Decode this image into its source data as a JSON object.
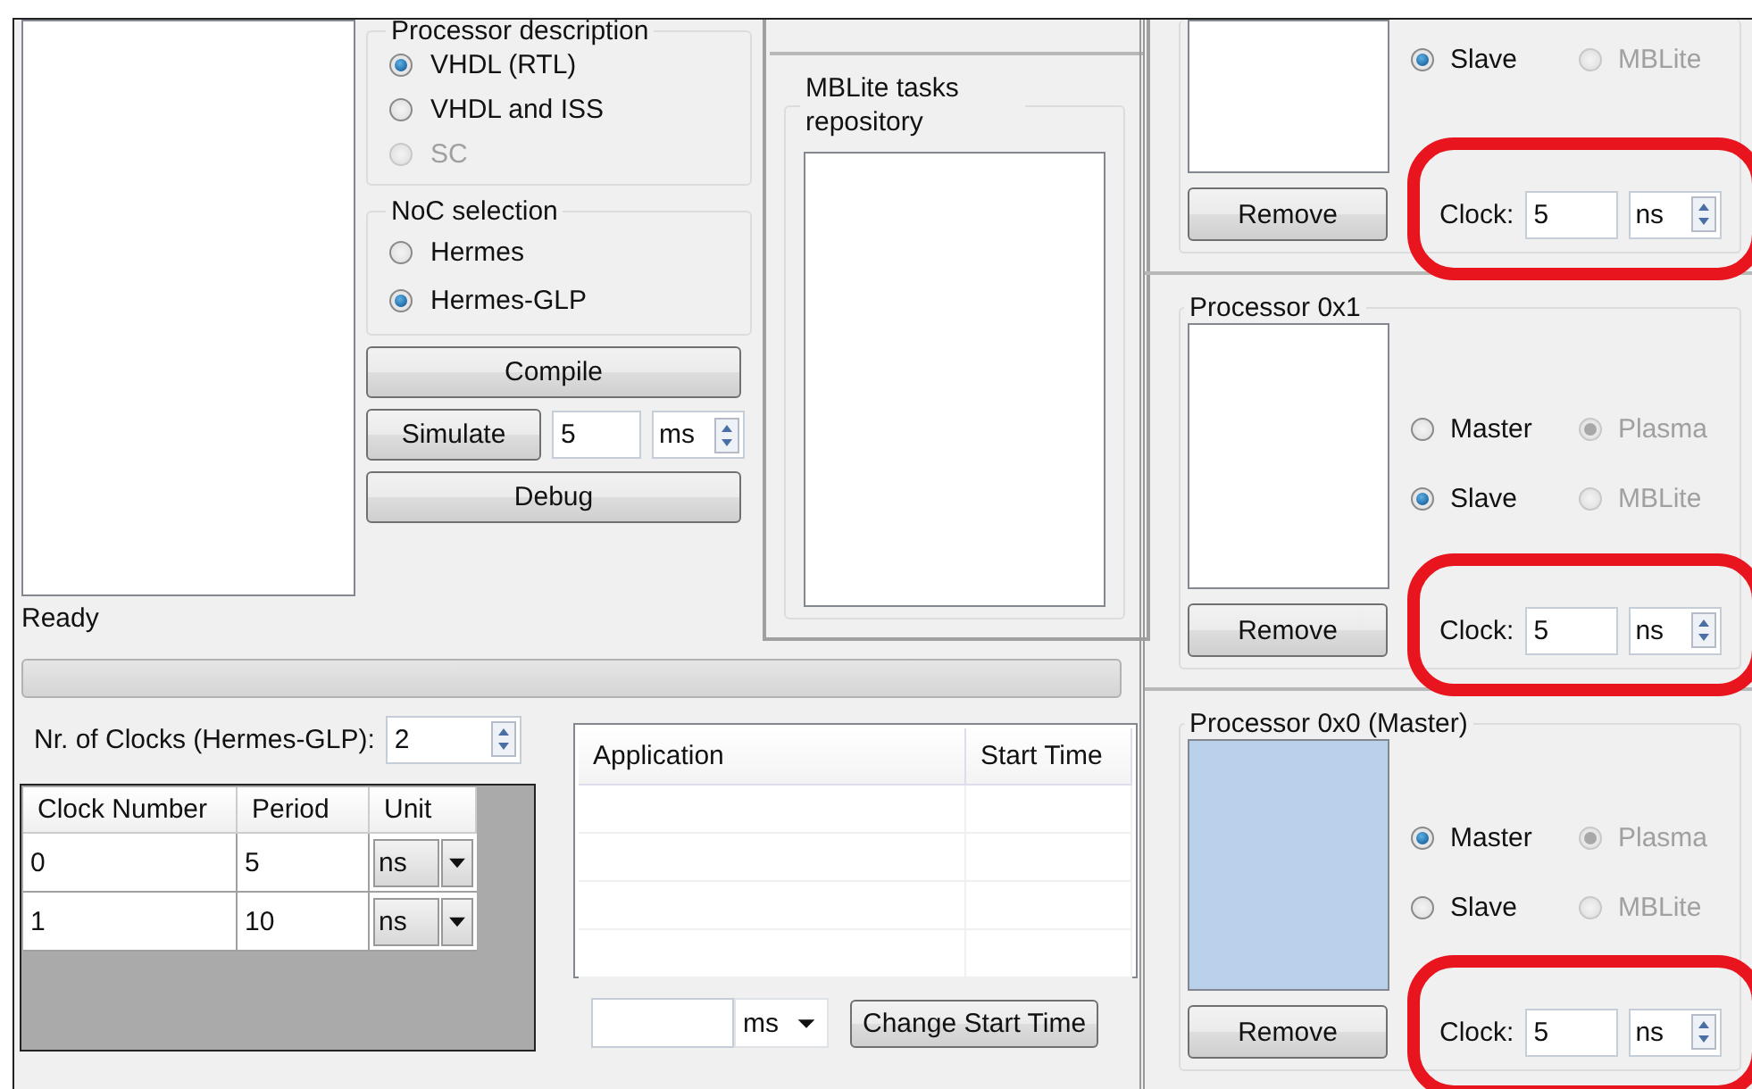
{
  "status": "Ready",
  "processor_description": {
    "title": "Processor description",
    "options": [
      {
        "label": "VHDL (RTL)",
        "selected": true,
        "disabled": false
      },
      {
        "label": "VHDL and ISS",
        "selected": false,
        "disabled": false
      },
      {
        "label": "SC",
        "selected": false,
        "disabled": true
      }
    ]
  },
  "noc_selection": {
    "title": "NoC selection",
    "options": [
      {
        "label": "Hermes",
        "selected": false,
        "disabled": false
      },
      {
        "label": "Hermes-GLP",
        "selected": true,
        "disabled": false
      }
    ]
  },
  "compile_button": "Compile",
  "simulate": {
    "button": "Simulate",
    "value": "5",
    "unit": "ms"
  },
  "debug_button": "Debug",
  "mblite_repository": {
    "title": "MBLite tasks repository"
  },
  "progress": {
    "level": 0
  },
  "clocks": {
    "label": "Nr. of Clocks (Hermes-GLP):",
    "value": "2",
    "columns": [
      "Clock Number",
      "Period",
      "Unit"
    ],
    "rows": [
      {
        "clock": "0",
        "period": "5",
        "unit": "ns"
      },
      {
        "clock": "1",
        "period": "10",
        "unit": "ns"
      }
    ]
  },
  "applications": {
    "columns": [
      "Application",
      "Start Time"
    ]
  },
  "start_time": {
    "unit": "ms",
    "button": "Change Start Time"
  },
  "processors": [
    {
      "selected": false,
      "highlighted": true,
      "radio_rows": [
        [
          {
            "label": "Slave",
            "selected": true,
            "disabled": false
          },
          {
            "label": "MBLite",
            "selected": false,
            "disabled": true
          }
        ]
      ],
      "remove_button": "Remove",
      "clock_label": "Clock:",
      "clock_value": "5",
      "clock_unit": "ns"
    },
    {
      "title": "Processor 0x1",
      "selected": false,
      "highlighted": true,
      "radio_rows": [
        [
          {
            "label": "Master",
            "selected": false,
            "disabled": false
          },
          {
            "label": "Plasma",
            "selected": true,
            "disabled": true
          }
        ],
        [
          {
            "label": "Slave",
            "selected": true,
            "disabled": false
          },
          {
            "label": "MBLite",
            "selected": false,
            "disabled": true
          }
        ]
      ],
      "remove_button": "Remove",
      "clock_label": "Clock:",
      "clock_value": "5",
      "clock_unit": "ns"
    },
    {
      "title": "Processor 0x0 (Master)",
      "selected": true,
      "highlighted": true,
      "radio_rows": [
        [
          {
            "label": "Master",
            "selected": true,
            "disabled": false
          },
          {
            "label": "Plasma",
            "selected": true,
            "disabled": true
          }
        ],
        [
          {
            "label": "Slave",
            "selected": false,
            "disabled": false
          },
          {
            "label": "MBLite",
            "selected": false,
            "disabled": true
          }
        ]
      ],
      "remove_button": "Remove",
      "clock_label": "Clock:",
      "clock_value": "5",
      "clock_unit": "ns"
    }
  ]
}
